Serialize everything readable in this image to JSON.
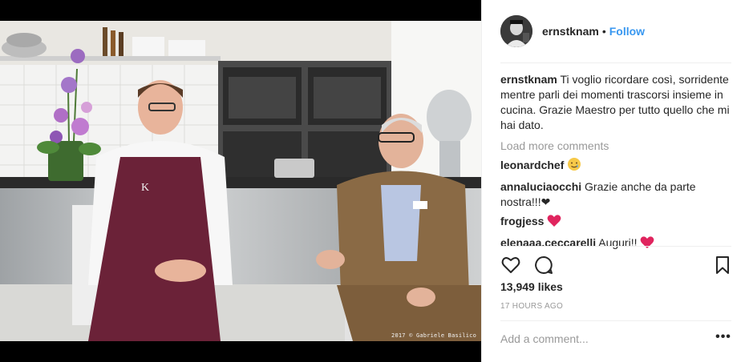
{
  "post": {
    "watermark": "2017 © Gabriele Basilico"
  },
  "header": {
    "username": "ernstknam",
    "separator": "•",
    "follow_label": "Follow"
  },
  "caption": {
    "username": "ernstknam",
    "text": "Ti voglio ricordare così, sorridente mentre parli dei momenti trascorsi insieme in cucina. Grazie Maestro per tutto quello che mi hai dato."
  },
  "load_more_label": "Load more comments",
  "comments": [
    {
      "username": "leonardchef",
      "text": "",
      "emoji": "smile-tear-emoji"
    },
    {
      "username": "annaluciaocchi",
      "text": "Grazie anche da parte nostra!!!❤",
      "emoji": ""
    },
    {
      "username": "frogjess",
      "text": "",
      "emoji": "red-heart-emoji"
    },
    {
      "username": "elenaaa.ceccarelli",
      "text": "Auguri!!",
      "emoji": "red-heart-emoji"
    }
  ],
  "actions": {
    "like_icon": "heart-outline-icon",
    "comment_icon": "comment-bubble-icon",
    "save_icon": "bookmark-icon"
  },
  "likes_label": "13,949 likes",
  "timestamp": "17 HOURS AGO",
  "add_comment": {
    "placeholder": "Add a comment..."
  },
  "more_label": "•••",
  "colors": {
    "follow": "#3897f0",
    "heart": "#ed4956",
    "muted": "#999999"
  }
}
